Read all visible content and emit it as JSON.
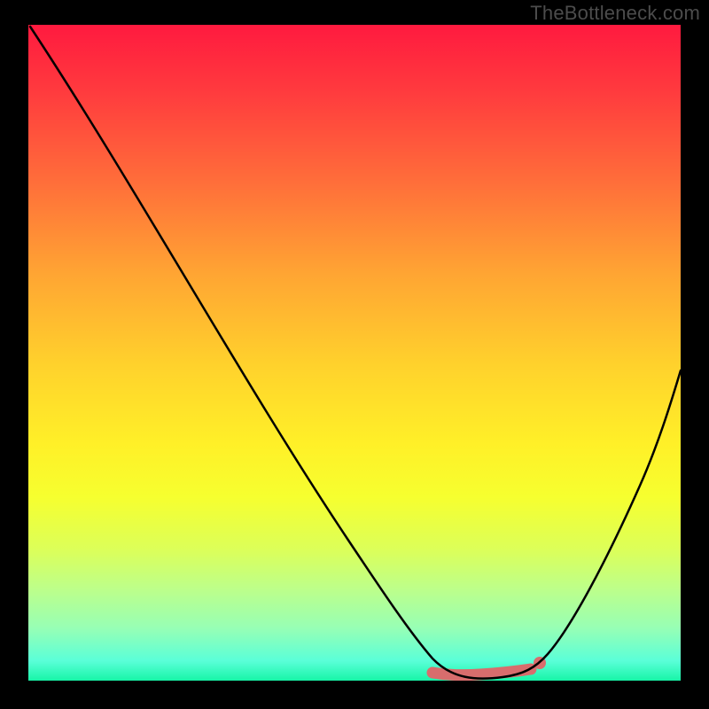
{
  "watermark": {
    "text": "TheBottleneck.com"
  },
  "chart_data": {
    "type": "line",
    "title": "",
    "subtitle": "",
    "xlabel": "",
    "ylabel": "",
    "xlim": [
      0,
      100
    ],
    "ylim": [
      0,
      100
    ],
    "grid": false,
    "legend": false,
    "background": "vertical-gradient-red-to-green",
    "series": [
      {
        "name": "bottleneck-curve",
        "color_mode": "black-on-gradient",
        "x": [
          0,
          5,
          10,
          15,
          20,
          25,
          30,
          35,
          40,
          45,
          50,
          55,
          60,
          63,
          66,
          70,
          74,
          77,
          80,
          85,
          90,
          95,
          100
        ],
        "y": [
          100,
          92,
          84,
          76,
          68,
          60,
          52,
          44,
          36,
          28,
          20,
          13,
          6,
          2,
          0,
          0,
          0,
          1,
          4,
          13,
          25,
          38,
          53
        ]
      }
    ],
    "annotations": [
      {
        "type": "highlight-segment",
        "color": "#d86d6d",
        "x_range": [
          62,
          77
        ],
        "y": 0.8
      },
      {
        "type": "dot",
        "color": "#d86d6d",
        "x": 78,
        "y": 2
      }
    ]
  }
}
